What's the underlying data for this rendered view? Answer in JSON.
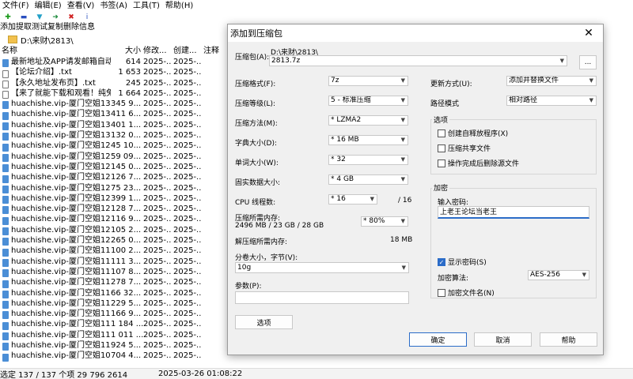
{
  "menu": [
    "文件(F)",
    "编辑(E)",
    "查看(V)",
    "书签(A)",
    "工具(T)",
    "帮助(H)"
  ],
  "toolbar": {
    "add": "添加",
    "extract": "提取",
    "test": "测试",
    "copy": "复制",
    "delete": "删除",
    "info": "信息"
  },
  "address": "D:\\来财\\2813\\",
  "columns": {
    "name": "名称",
    "size": "大小",
    "modified": "修改...",
    "created": "创建...",
    "note": "注释"
  },
  "files": [
    {
      "name": "最新地址及APP请发邮箱自动...",
      "size": "614",
      "mod": "2025-...",
      "cre": "2025-...",
      "type": "doc"
    },
    {
      "name": "【论坛介绍】.txt",
      "size": "1 653",
      "mod": "2025-...",
      "cre": "2025-...",
      "type": "txt"
    },
    {
      "name": "【永久地址发布页】.txt",
      "size": "245",
      "mod": "2025-...",
      "cre": "2025-...",
      "type": "txt"
    },
    {
      "name": "【来了就能下载和观看！纯免...",
      "size": "1 664",
      "mod": "2025-...",
      "cre": "2025-...",
      "type": "txt"
    },
    {
      "name": "huachishe.vip-厦门空姐133....",
      "size": "345 9...",
      "mod": "2025-...",
      "cre": "2025-...",
      "type": "doc"
    },
    {
      "name": "huachishe.vip-厦门空姐132....",
      "size": "411 6...",
      "mod": "2025-...",
      "cre": "2025-...",
      "type": "doc"
    },
    {
      "name": "huachishe.vip-厦门空姐131....",
      "size": "401 1...",
      "mod": "2025-...",
      "cre": "2025-...",
      "type": "doc"
    },
    {
      "name": "huachishe.vip-厦门空姐130....",
      "size": "132 0...",
      "mod": "2025-...",
      "cre": "2025-...",
      "type": "doc"
    },
    {
      "name": "huachishe.vip-厦门空姐129....",
      "size": "45 10...",
      "mod": "2025-...",
      "cre": "2025-...",
      "type": "doc"
    },
    {
      "name": "huachishe.vip-厦门空姐128....",
      "size": "59 09...",
      "mod": "2025-...",
      "cre": "2025-...",
      "type": "doc"
    },
    {
      "name": "huachishe.vip-厦门空姐127....",
      "size": "145 0...",
      "mod": "2025-...",
      "cre": "2025-...",
      "type": "doc"
    },
    {
      "name": "huachishe.vip-厦门空姐126....",
      "size": "126 7...",
      "mod": "2025-...",
      "cre": "2025-...",
      "type": "doc"
    },
    {
      "name": "huachishe.vip-厦门空姐125....",
      "size": "75 23...",
      "mod": "2025-...",
      "cre": "2025-...",
      "type": "doc"
    },
    {
      "name": "huachishe.vip-厦门空姐124....",
      "size": "399 1...",
      "mod": "2025-...",
      "cre": "2025-...",
      "type": "doc"
    },
    {
      "name": "huachishe.vip-厦门空姐123....",
      "size": "128 7...",
      "mod": "2025-...",
      "cre": "2025-...",
      "type": "doc"
    },
    {
      "name": "huachishe.vip-厦门空姐122....",
      "size": "116 9...",
      "mod": "2025-...",
      "cre": "2025-...",
      "type": "doc"
    },
    {
      "name": "huachishe.vip-厦门空姐121....",
      "size": "105 2...",
      "mod": "2025-...",
      "cre": "2025-...",
      "type": "doc"
    },
    {
      "name": "huachishe.vip-厦门空姐120....",
      "size": "265 0...",
      "mod": "2025-...",
      "cre": "2025-...",
      "type": "doc"
    },
    {
      "name": "huachishe.vip-厦门空姐119....",
      "size": "100 2...",
      "mod": "2025-...",
      "cre": "2025-...",
      "type": "doc"
    },
    {
      "name": "huachishe.vip-厦门空姐118....",
      "size": "111 3...",
      "mod": "2025-...",
      "cre": "2025-...",
      "type": "doc"
    },
    {
      "name": "huachishe.vip-厦门空姐117....",
      "size": "107 8...",
      "mod": "2025-...",
      "cre": "2025-...",
      "type": "doc"
    },
    {
      "name": "huachishe.vip-厦门空姐116....",
      "size": "278 7...",
      "mod": "2025-...",
      "cre": "2025-...",
      "type": "doc"
    },
    {
      "name": "huachishe.vip-厦门空姐115....",
      "size": "66 32...",
      "mod": "2025-...",
      "cre": "2025-...",
      "type": "doc"
    },
    {
      "name": "huachishe.vip-厦门空姐114....",
      "size": "229 5...",
      "mod": "2025-...",
      "cre": "2025-...",
      "type": "doc"
    },
    {
      "name": "huachishe.vip-厦门空姐113....",
      "size": "166 9...",
      "mod": "2025-...",
      "cre": "2025-...",
      "type": "doc"
    },
    {
      "name": "huachishe.vip-厦门空姐112....",
      "size": "1 184 ...",
      "mod": "2025-...",
      "cre": "2025-...",
      "type": "doc"
    },
    {
      "name": "huachishe.vip-厦门空姐111....",
      "size": "1 011 ...",
      "mod": "2025-...",
      "cre": "2025-...",
      "type": "doc"
    },
    {
      "name": "huachishe.vip-厦门空姐110....",
      "size": "924 5...",
      "mod": "2025-...",
      "cre": "2025-...",
      "type": "doc"
    },
    {
      "name": "huachishe.vip-厦门空姐109....",
      "size": "704 4...",
      "mod": "2025-...",
      "cre": "2025-...",
      "type": "doc"
    }
  ],
  "status": {
    "selection": "选定 137 / 137 个项 29 796 2614",
    "datetime": "2025-03-26 01:08:22"
  },
  "dialog": {
    "title": "添加到压缩包",
    "archive_label": "压缩包(A):",
    "archive_dir": "D:\\来财\\2813\\",
    "archive_name": "2813.7z",
    "browse": "...",
    "format_label": "压缩格式(F):",
    "format_value": "7z",
    "level_label": "压缩等级(L):",
    "level_value": "5 - 标准压缩",
    "method_label": "压缩方法(M):",
    "method_value": "* LZMA2",
    "dict_label": "字典大小(D):",
    "dict_value": "* 16 MB",
    "word_label": "单词大小(W):",
    "word_value": "* 32",
    "solid_label": "固实数据大小:",
    "solid_value": "* 4 GB",
    "threads_label": "CPU 线程数:",
    "threads_value": "* 16",
    "threads_max": "/ 16",
    "mem_label": "压缩所需内存:",
    "mem_value": "2496 MB / 23 GB / 28 GB",
    "mem_pct": "* 80%",
    "demem_label": "解压缩所需内存:",
    "demem_value": "18 MB",
    "split_label": "分卷大小，字节(V):",
    "split_value": "10g",
    "params_label": "参数(P):",
    "params_value": "",
    "options_button": "选项",
    "update_label": "更新方式(U):",
    "update_value": "添加并替换文件",
    "path_label": "路径模式",
    "path_value": "相对路径",
    "options_group": "选项",
    "opt_sfx": "创建自释放程序(X)",
    "opt_shared": "压缩共享文件",
    "opt_delete": "操作完成后删除源文件",
    "encrypt_group": "加密",
    "password_label": "输入密码:",
    "password_value": "上老王论坛当老王",
    "show_password": "显示密码(S)",
    "enc_method_label": "加密算法:",
    "enc_method_value": "AES-256",
    "enc_names": "加密文件名(N)",
    "ok": "确定",
    "cancel": "取消",
    "help": "帮助"
  }
}
